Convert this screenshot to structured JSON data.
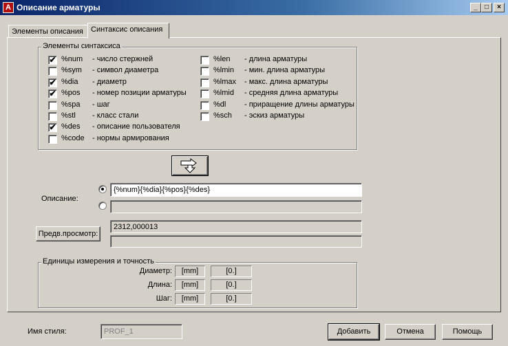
{
  "window": {
    "title": "Описание арматуры",
    "app_icon": "app-icon",
    "controls": [
      "minimize-icon",
      "maximize-icon",
      "close-icon"
    ]
  },
  "tabs": [
    {
      "label": "Элементы описания"
    },
    {
      "label": "Синтаксис описания",
      "active": true
    }
  ],
  "syntax_group": {
    "title": "Элементы синтаксиса",
    "left_items": [
      {
        "code": "%num",
        "desc": "- число стержней",
        "checked": true
      },
      {
        "code": "%sym",
        "desc": "- символ диаметра",
        "checked": false
      },
      {
        "code": "%dia",
        "desc": "- диаметр",
        "checked": true
      },
      {
        "code": "%pos",
        "desc": "- номер позиции арматуры",
        "checked": true
      },
      {
        "code": "%spa",
        "desc": "- шаг",
        "checked": false
      },
      {
        "code": "%stl",
        "desc": "- класс стали",
        "checked": false
      },
      {
        "code": "%des",
        "desc": "- описание пользователя",
        "checked": true
      },
      {
        "code": "%code",
        "desc": "- нормы армирования",
        "checked": false
      }
    ],
    "right_items": [
      {
        "code": "%len",
        "desc": "- длина арматуры",
        "checked": false
      },
      {
        "code": "%lmin",
        "desc": "- мин. длина арматуры",
        "checked": false
      },
      {
        "code": "%lmax",
        "desc": "- макс. длина арматуры",
        "checked": false
      },
      {
        "code": "%lmid",
        "desc": "- средняя длина арматуры",
        "checked": false
      },
      {
        "code": "%dl",
        "desc": "- приращение длины арматуры",
        "checked": false
      },
      {
        "code": "%sch",
        "desc": "- эскиз арматуры",
        "checked": false
      }
    ]
  },
  "insert_button_icon": "insert-arrow-icon",
  "description": {
    "label": "Описание:",
    "field1_value": "{%num}{%dia}{%pos}{%des}",
    "field2_value": ""
  },
  "preview": {
    "button_label": "Предв.просмотр:",
    "line1": "2312,000013",
    "line2": ""
  },
  "units_group": {
    "title": "Единицы измерения и точность",
    "rows": [
      {
        "label": "Диаметр:",
        "unit": "[mm]",
        "precision": "[0.]"
      },
      {
        "label": "Длина:",
        "unit": "[mm]",
        "precision": "[0.]"
      },
      {
        "label": "Шаг:",
        "unit": "[mm]",
        "precision": "[0.]"
      }
    ]
  },
  "footer": {
    "style_label": "Имя стиля:",
    "style_value": "PROF_1",
    "add_label": "Добавить",
    "cancel_label": "Отмена",
    "help_label": "Помощь"
  }
}
